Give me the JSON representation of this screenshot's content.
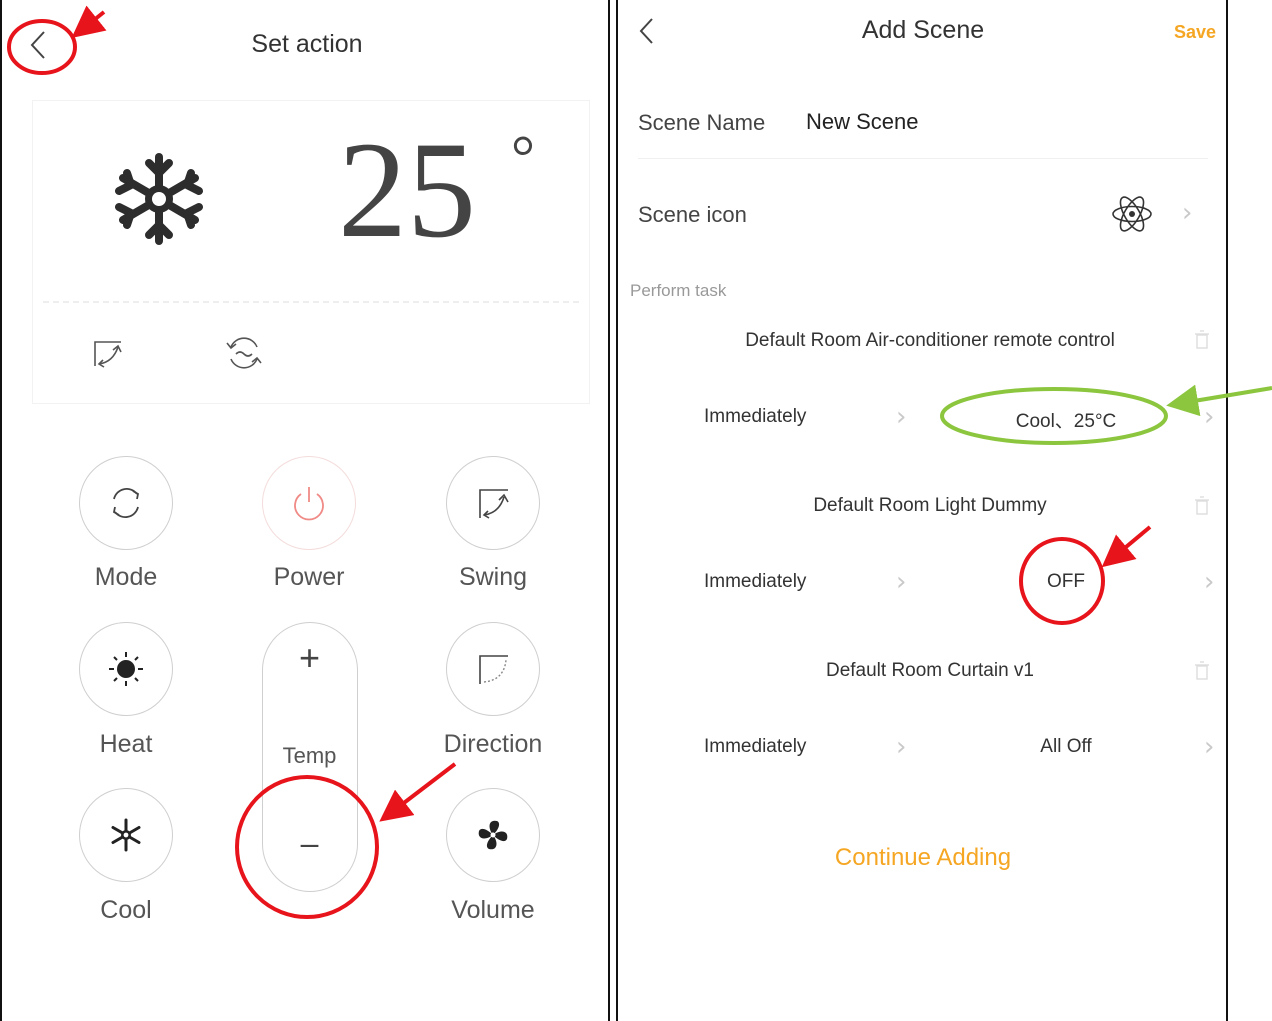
{
  "set_action": {
    "title": "Set action",
    "temperature": "25",
    "degree_symbol": "°",
    "buttons": {
      "mode": "Mode",
      "power": "Power",
      "swing": "Swing",
      "heat": "Heat",
      "direction": "Direction",
      "cool": "Cool",
      "volume": "Volume",
      "temp": "Temp",
      "temp_plus": "+",
      "temp_minus": "–"
    }
  },
  "add_scene": {
    "title": "Add Scene",
    "save_label": "Save",
    "scene_name_label": "Scene Name",
    "scene_name_value": "New Scene",
    "scene_icon_label": "Scene icon",
    "section_label": "Perform task",
    "tasks": [
      {
        "device": "Default Room Air-conditioner remote control",
        "timing": "Immediately",
        "action": "Cool、25°C"
      },
      {
        "device": "Default Room Light Dummy",
        "timing": "Immediately",
        "action": "OFF"
      },
      {
        "device": "Default Room Curtain v1",
        "timing": "Immediately",
        "action": "All Off"
      }
    ],
    "continue_label": "Continue Adding"
  },
  "colors": {
    "accent_orange": "#f5a623",
    "annotation_red": "#e8141b",
    "annotation_green": "#8cc63f",
    "power_red": "#f08a86"
  }
}
